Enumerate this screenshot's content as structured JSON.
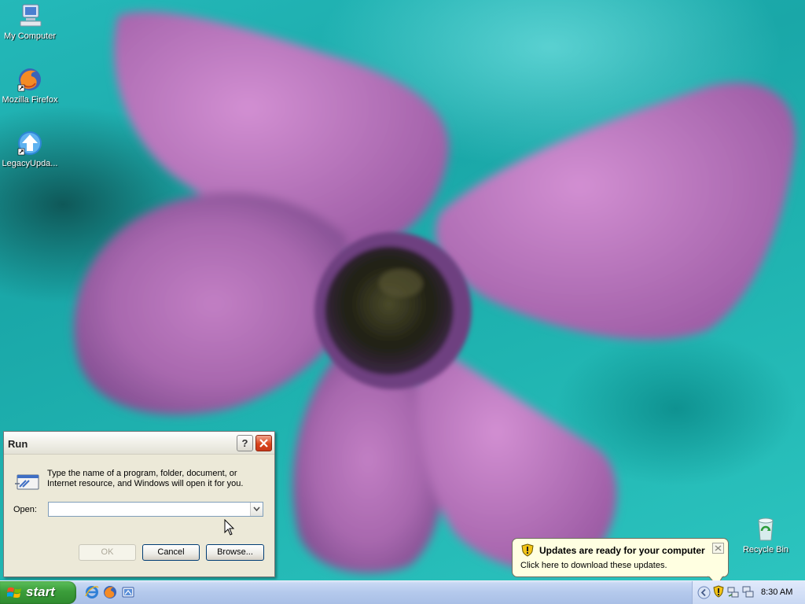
{
  "desktop": {
    "icons": [
      {
        "label": "My Computer",
        "icon": "my-computer-icon"
      },
      {
        "label": "Mozilla Firefox",
        "icon": "firefox-icon"
      },
      {
        "label": "LegacyUpda...",
        "icon": "legacy-update-icon"
      },
      {
        "label": "Recycle Bin",
        "icon": "recycle-bin-icon"
      }
    ]
  },
  "run_dialog": {
    "title": "Run",
    "help_label": "?",
    "prompt": "Type the name of a program, folder, document, or Internet resource, and Windows will open it for you.",
    "open_label": "Open:",
    "open_value": "",
    "ok_label": "OK",
    "cancel_label": "Cancel",
    "browse_label": "Browse..."
  },
  "balloon": {
    "title": "Updates are ready for your computer",
    "text": "Click here to download these updates."
  },
  "taskbar": {
    "start_label": "start",
    "quick_launch": [
      "internet-explorer-icon",
      "firefox-icon",
      "show-desktop-icon"
    ],
    "clock": "8:30 AM"
  },
  "colors": {
    "dialog_bg": "#ece9d8",
    "balloon_bg": "#ffffe1",
    "start_green": "#3b9d3a",
    "taskbar_blue": "#b4c9ec"
  }
}
